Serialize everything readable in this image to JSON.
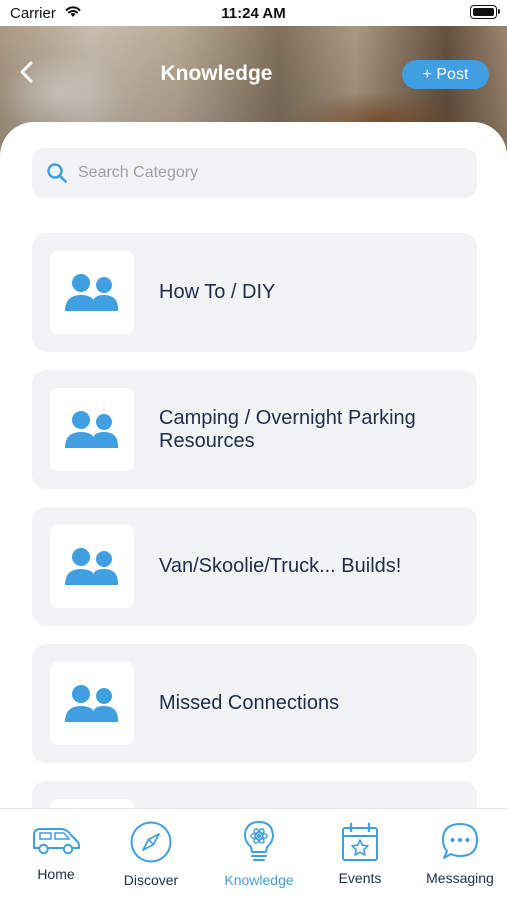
{
  "status_bar": {
    "carrier": "Carrier",
    "time": "11:24 AM"
  },
  "header": {
    "title": "Knowledge",
    "post_button": "+ Post",
    "back_icon": "chevron-left-icon"
  },
  "search": {
    "placeholder": "Search Category",
    "value": "",
    "icon": "search-icon"
  },
  "categories": [
    {
      "label": "How To / DIY",
      "icon": "group-icon"
    },
    {
      "label": "Camping / Overnight Parking Resources",
      "icon": "group-icon"
    },
    {
      "label": "Van/Skoolie/Truck... Builds!",
      "icon": "group-icon"
    },
    {
      "label": "Missed Connections",
      "icon": "group-icon"
    },
    {
      "label": "",
      "icon": "group-icon"
    }
  ],
  "tabbar": {
    "tabs": [
      {
        "label": "Home",
        "icon": "van-icon"
      },
      {
        "label": "Discover",
        "icon": "compass-icon"
      },
      {
        "label": "Knowledge",
        "icon": "lightbulb-icon",
        "active": true
      },
      {
        "label": "Events",
        "icon": "calendar-star-icon"
      },
      {
        "label": "Messaging",
        "icon": "chat-bubble-icon"
      }
    ]
  },
  "colors": {
    "accent": "#3f9fe0",
    "card_bg": "#f2f3f5",
    "text_dark": "#1f2d4a",
    "icon_tint": "#3f9fe0"
  }
}
